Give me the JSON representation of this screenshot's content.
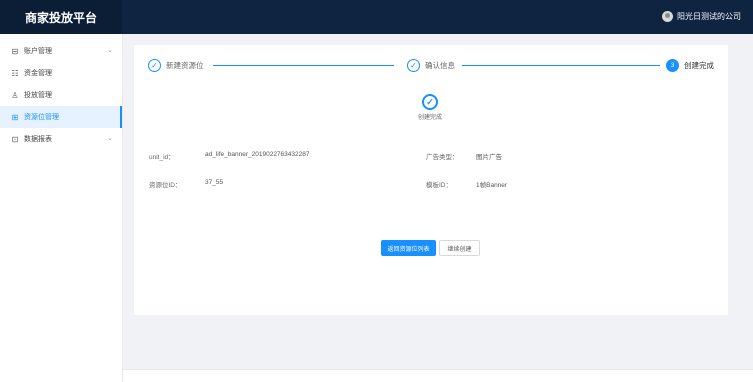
{
  "header": {
    "app_title": "商家投放平台",
    "company_name": "阳光日测试的公司"
  },
  "sidebar": {
    "items": [
      {
        "label": "账户管理",
        "icon": "account-icon",
        "icon_glyph": "⊟",
        "expandable": true
      },
      {
        "label": "资金管理",
        "icon": "funds-icon",
        "icon_glyph": "☷",
        "expandable": false
      },
      {
        "label": "投放管理",
        "icon": "delivery-icon",
        "icon_glyph": "♙",
        "expandable": false
      },
      {
        "label": "资源位管理",
        "icon": "grid-icon",
        "icon_glyph": "⊞",
        "expandable": false,
        "active": true
      },
      {
        "label": "数据报表",
        "icon": "report-icon",
        "icon_glyph": "⊡",
        "expandable": true
      }
    ],
    "chevron_glyph": "⌄"
  },
  "steps": [
    {
      "label": "新建资源位",
      "status": "done",
      "glyph": "✓"
    },
    {
      "label": "确认信息",
      "status": "done",
      "glyph": "✓"
    },
    {
      "label": "创建完成",
      "status": "current",
      "glyph": "3"
    }
  ],
  "result": {
    "icon_glyph": "✓",
    "text": "创建完成"
  },
  "details": {
    "unit_id_label": "unit_id：",
    "unit_id_value": "ad_life_banner_2019022763432287",
    "ad_type_label": "广告类型：",
    "ad_type_value": "图片广告",
    "resource_id_label": "资源位ID：",
    "resource_id_value": "37_55",
    "template_id_label": "模板ID：",
    "template_id_value": "1帧Banner"
  },
  "actions": {
    "back_label": "返回资源位列表",
    "continue_label": "继续创建"
  },
  "colors": {
    "header_bg": "#0f2440",
    "accent": "#1890ff",
    "content_bg": "#f0f2f5"
  }
}
